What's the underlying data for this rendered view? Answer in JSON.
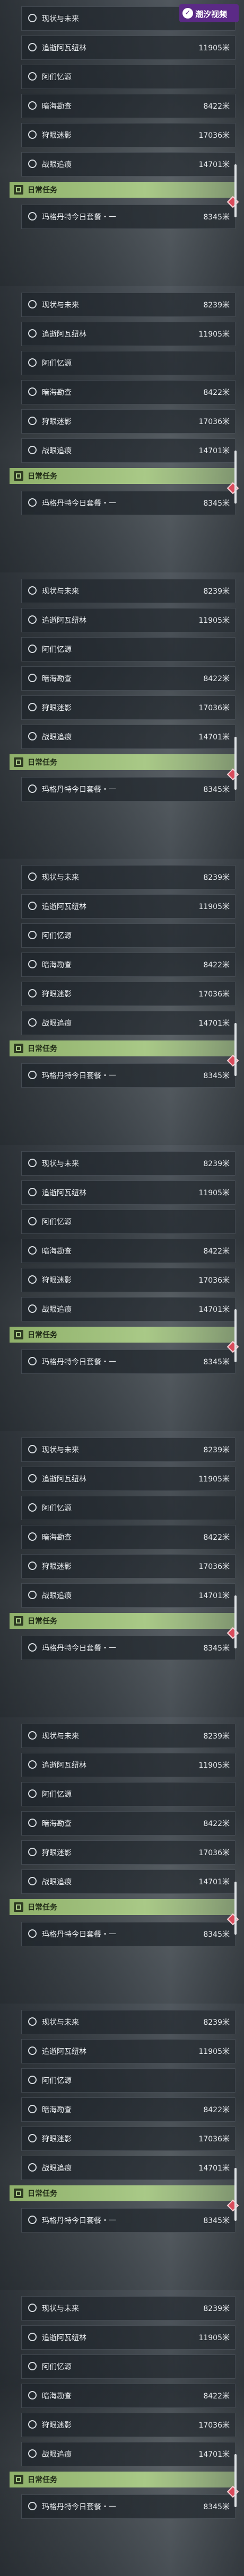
{
  "app": {
    "logo_text": "潮汐视频"
  },
  "locations": [
    {
      "name": "现状与未来",
      "distance": "8239米"
    },
    {
      "name": "追逝阿瓦纽林",
      "distance": "11905米"
    },
    {
      "name": "阿们忆源",
      "distance": ""
    },
    {
      "name": "暗海勘查",
      "distance": "8422米"
    },
    {
      "name": "狩眼迷影",
      "distance": "17036米"
    },
    {
      "name": "战眼追痕",
      "distance": "14701米"
    }
  ],
  "daily": {
    "header": "日常任务",
    "quest_name": "玛格丹特今日套餐・一",
    "quest_distance": "8345米"
  },
  "icons": {
    "check": "circle-check-icon",
    "header": "daily-task-icon",
    "marker": "quest-marker-icon"
  },
  "colors": {
    "header_green": "#a9c987",
    "marker_red": "#d94a5a",
    "logo_purple": "#5b2a86"
  }
}
